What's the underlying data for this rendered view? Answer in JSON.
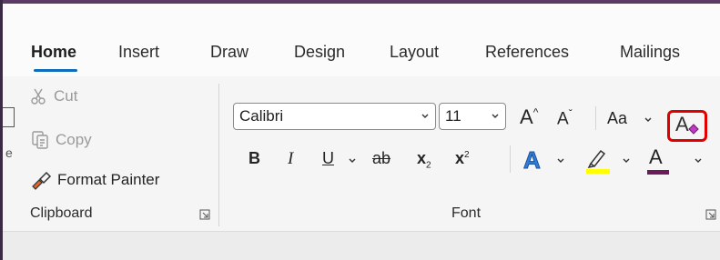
{
  "tabs": [
    {
      "label": "Home",
      "active": true
    },
    {
      "label": "Insert"
    },
    {
      "label": "Draw"
    },
    {
      "label": "Design"
    },
    {
      "label": "Layout"
    },
    {
      "label": "References"
    },
    {
      "label": "Mailings"
    }
  ],
  "clipboard": {
    "cut_label": "Cut",
    "copy_label": "Copy",
    "format_painter_label": "Format Painter",
    "group_label": "Clipboard"
  },
  "font": {
    "font_name": "Calibri",
    "font_size": "11",
    "grow_label": "A",
    "shrink_label": "A",
    "change_case_label": "Aa",
    "bold_label": "B",
    "italic_label": "I",
    "underline_label": "U",
    "strikethrough_label": "ab",
    "subscript_label": "x",
    "subscript_sup": "2",
    "superscript_label": "x",
    "superscript_sup": "2",
    "font_color_label": "A",
    "group_label": "Font",
    "colors": {
      "highlight": "#ffff00",
      "font_color": "#6b1a5a",
      "accent": "#0f6cbd",
      "callout": "#e00000"
    }
  }
}
